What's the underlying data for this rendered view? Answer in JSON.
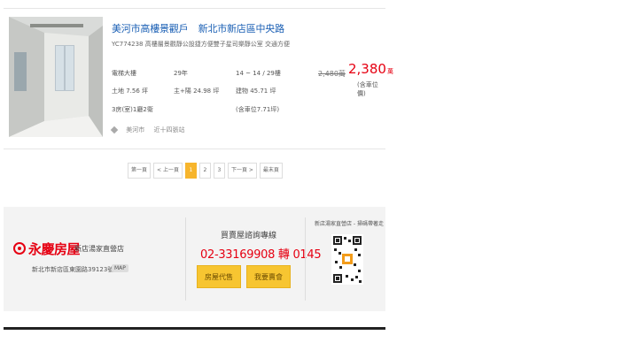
{
  "listing": {
    "title": "美河市高樓景觀戶",
    "location": "新北市新店區中央路",
    "subtitle": "YC774238 高樓層景觀靜公設捷方便雙子星司樂靜公室 交通方便",
    "specs": {
      "type": "電梯大樓",
      "age": "29年",
      "floor": "14 ~ 14 / 29樓",
      "land": "土地 7.56 坪",
      "main": "主+陽 24.98 坪",
      "building": "建物 45.71 坪",
      "layout": "3房(室)1廳2衛",
      "parking_note": "(含車位7.71坪)"
    },
    "old_price": "2,480萬",
    "price": "2,380",
    "price_unit": "萬",
    "price_note": "(含車位價)",
    "tags": [
      "美河市",
      "近十四張站"
    ]
  },
  "pagination": {
    "first": "第一頁",
    "prev": "< 上一頁",
    "pages": [
      "1",
      "2",
      "3"
    ],
    "active_page": "1",
    "next": "下一頁 >",
    "last": "最末頁"
  },
  "footer": {
    "brand": "永慶房屋",
    "branch": "新店湯家直營店",
    "address": "新北市新店區東園路39123號",
    "map_label": "MAP",
    "hotline_label": "買賣屋諮詢專線",
    "hotline_number": "02-33169908 轉 0145",
    "btn_sell": "房屋代售",
    "btn_buy": "我要賣會",
    "qr_label": "新店湯家直營店 - 掃碼帶著走"
  },
  "colors": {
    "price_red": "#e60012",
    "title_blue": "#1a5fb4",
    "accent_yellow": "#f7c531"
  }
}
